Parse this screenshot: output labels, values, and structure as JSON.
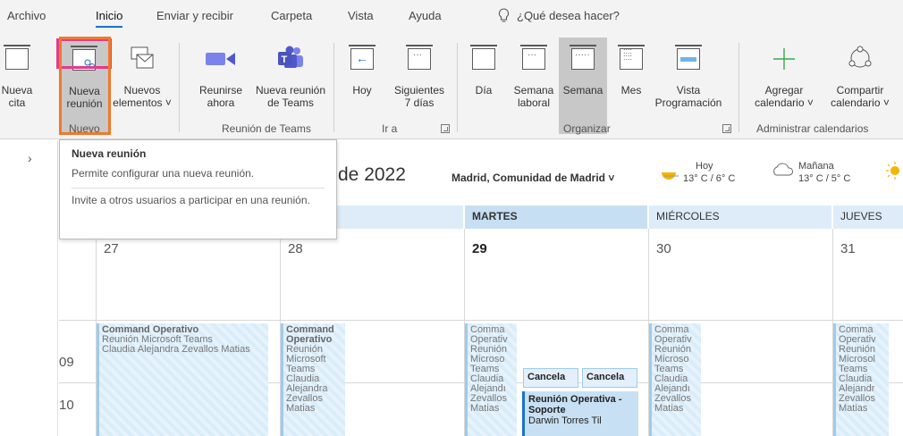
{
  "tabs": [
    "Archivo",
    "Inicio",
    "Enviar y recibir",
    "Carpeta",
    "Vista",
    "Ayuda"
  ],
  "search_label": "¿Qué desea hacer?",
  "ribbon": {
    "nueva_cita": [
      "Nueva",
      "cita"
    ],
    "nueva_reunion": [
      "Nueva",
      "reunión"
    ],
    "nuevos_elementos": [
      "Nuevos",
      "elementos ˅"
    ],
    "reunirse_ahora": [
      "Reunirse",
      "ahora"
    ],
    "nueva_reunion_teams": [
      "Nueva reunión",
      "de Teams"
    ],
    "hoy": "Hoy",
    "siguientes": [
      "Siguientes",
      "7 días"
    ],
    "dia": "Día",
    "semana_laboral": [
      "Semana",
      "laboral"
    ],
    "semana": "Semana",
    "mes": "Mes",
    "vista_programacion": [
      "Vista",
      "Programación"
    ],
    "agregar_calendario": [
      "Agregar",
      "calendario ˅"
    ],
    "compartir_calendario": [
      "Compartir",
      "calendario ˅"
    ]
  },
  "groups": [
    "Nuevo",
    "Reunión de Teams",
    "Ir a",
    "Organizar",
    "Administrar calendarios"
  ],
  "tooltip": {
    "title": "Nueva reunión",
    "line1": "Permite configurar una nueva reunión.",
    "line2": "Invite a otros usuarios a participar en una reunión."
  },
  "header": {
    "date_partial": "de 2022",
    "location": "Madrid, Comunidad de Madrid  ˅",
    "today_label": "Hoy",
    "today_temp": "13° C / 6° C",
    "tomorrow_label": "Mañana",
    "tomorrow_temp": "13° C / 5° C"
  },
  "days": [
    {
      "header": "",
      "num": "27"
    },
    {
      "header": "",
      "num": "28"
    },
    {
      "header": "MARTES",
      "num": "29"
    },
    {
      "header": "MIÉRCOLES",
      "num": "30"
    },
    {
      "header": "JUEVES",
      "num": "31"
    }
  ],
  "times": [
    "09",
    "10"
  ],
  "events": {
    "title1": "Command Operativo",
    "sub1": "Reunión Microsoft Teams",
    "who1": "Claudia Alejandra Zevallos Matias",
    "title2": "Command Operativo",
    "body2": "Reunión Microsoft Teams Claudia Alejandra Zevallos Matias",
    "col3": "Comma Operativ Reunión Microso Teams Claudia Alejandı Zevallos Matias",
    "col4": "Comma Operativ Reunión Microso Teams Claudia Alejandı Zevallos Matias",
    "col5": "Comma Operativ Reunión Microsol Teams Claudia Alejandr Zevallos Matias",
    "cancel1": "Cancela",
    "cancel2": "Cancela",
    "soporte_title": "Reunión Operativa - Soporte",
    "soporte_who": "Darwin Torres Til"
  }
}
